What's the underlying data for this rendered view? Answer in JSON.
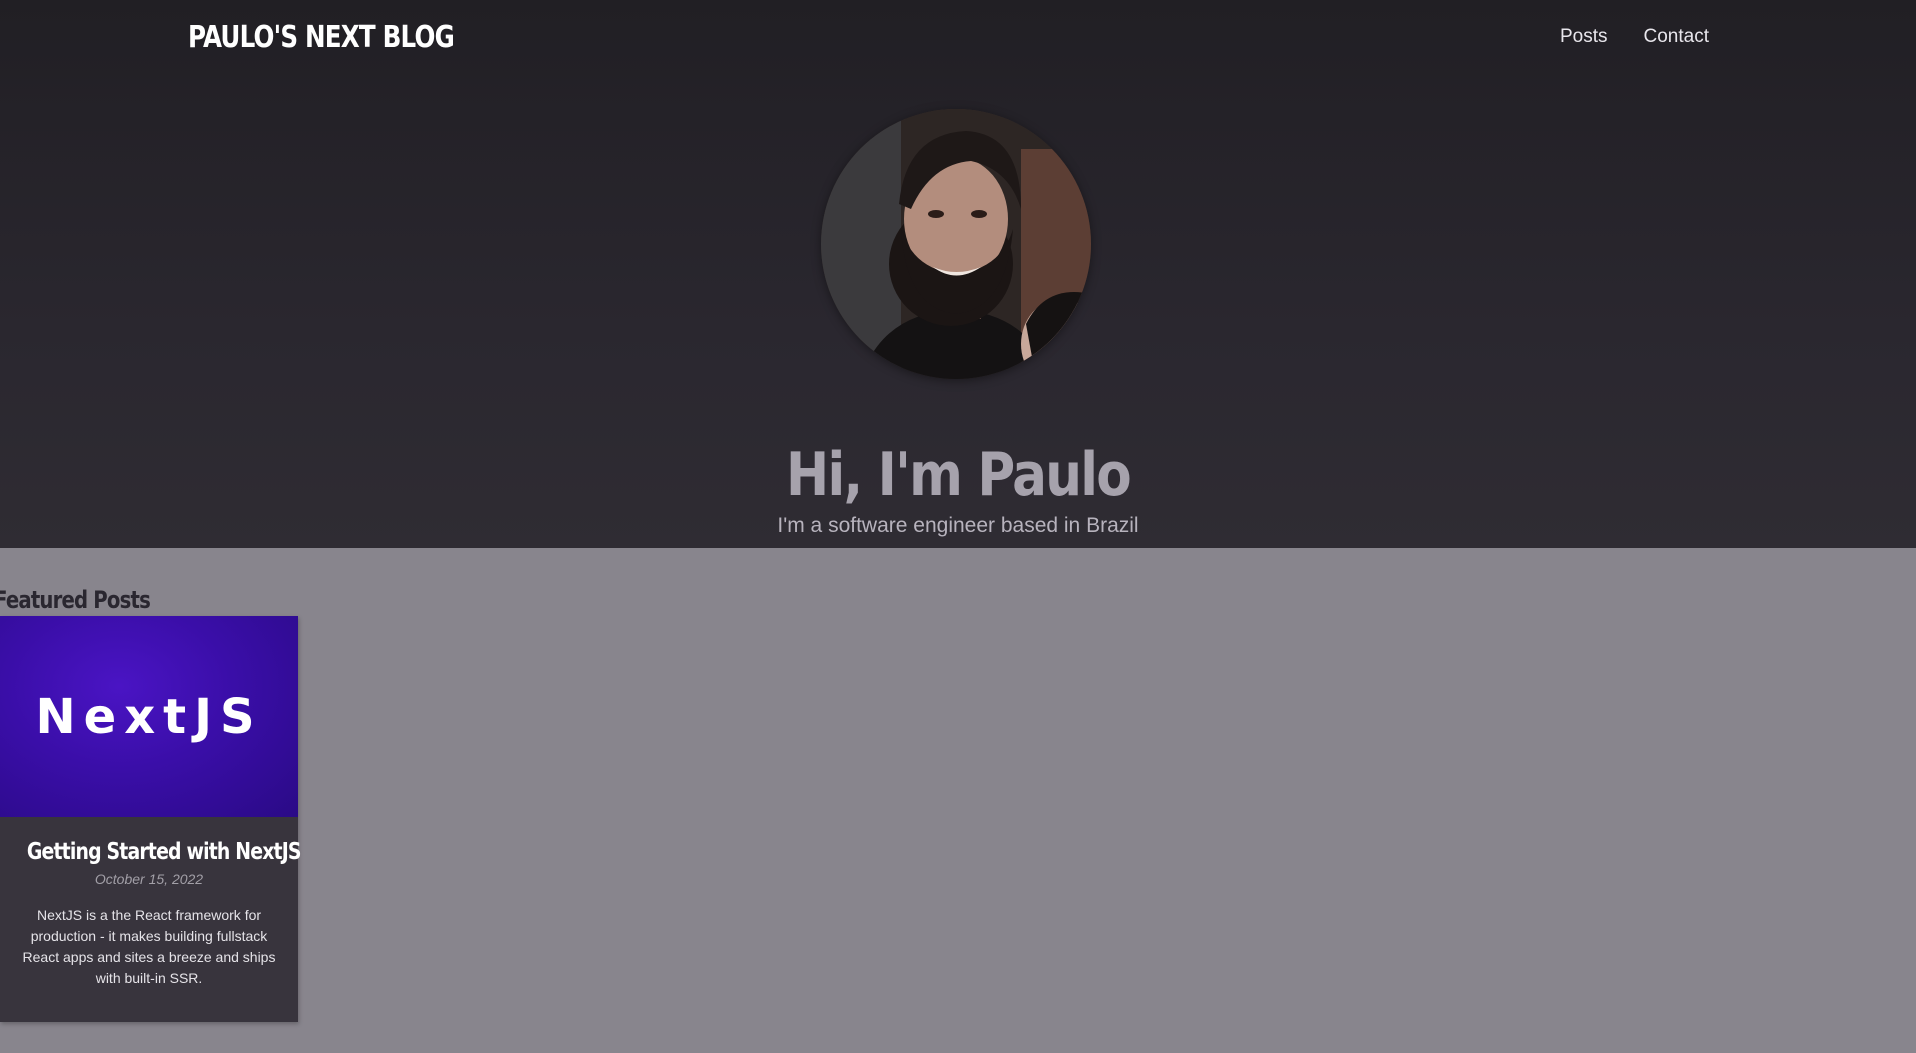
{
  "nav": {
    "brand": "PAULO'S NEXT BLOG",
    "links": [
      {
        "label": "Posts"
      },
      {
        "label": "Contact"
      }
    ]
  },
  "hero": {
    "title": "Hi, I'm Paulo",
    "subtitle": "I'm a software engineer based in Brazil"
  },
  "featured": {
    "heading": "Featured Posts",
    "posts": [
      {
        "image_text": "NextJS",
        "title": "Getting Started with NextJS",
        "date": "October 15, 2022",
        "excerpt": "NextJS is a the React framework for production - it makes building fullstack React apps and sites a breeze and ships with built-in SSR."
      }
    ]
  },
  "colors": {
    "hero_bg": "#29262d",
    "page_bg": "#88858d",
    "card_bg": "#38343d",
    "nextjs_purple": "#3a0ea8"
  }
}
